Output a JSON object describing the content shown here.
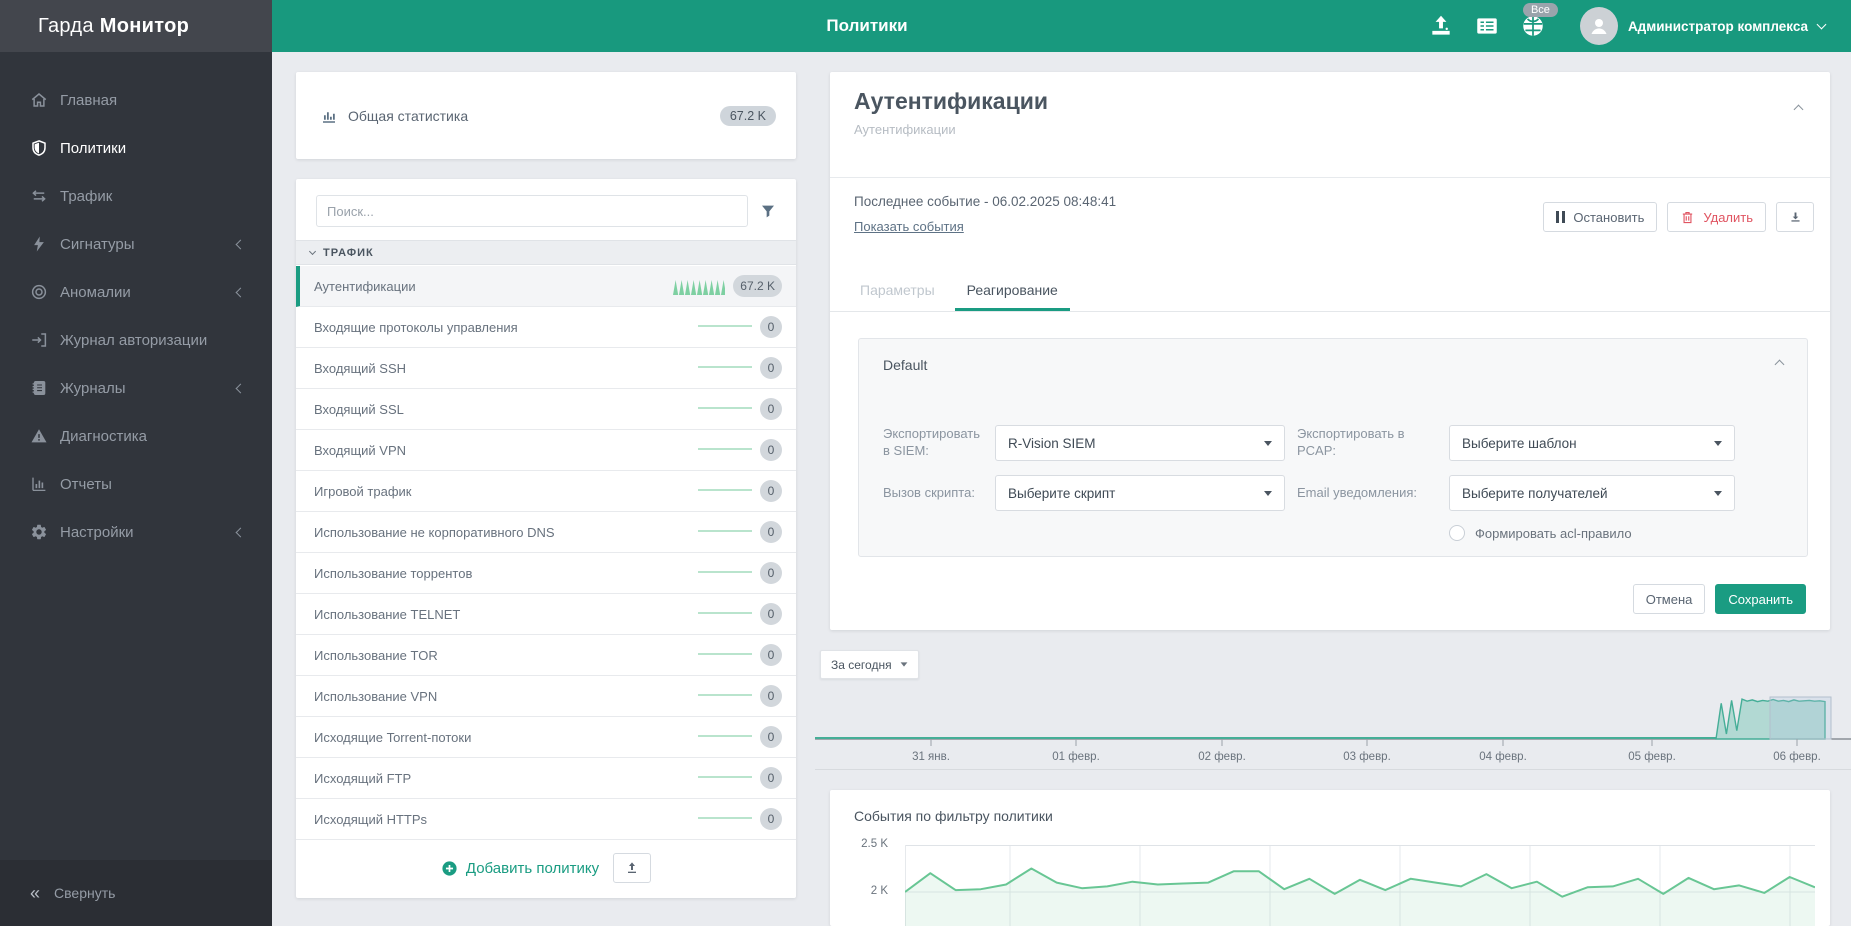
{
  "brand": {
    "regular": "Гарда",
    "bold": "Монитор"
  },
  "header": {
    "title": "Политики",
    "scope_badge": "Все",
    "user_name": "Администратор комплекса"
  },
  "sidebar": {
    "items": [
      {
        "label": "Главная",
        "icon": "home"
      },
      {
        "label": "Политики",
        "icon": "shield",
        "active": true
      },
      {
        "label": "Трафик",
        "icon": "swap"
      },
      {
        "label": "Сигнатуры",
        "icon": "bolt",
        "expandable": true
      },
      {
        "label": "Аномалии",
        "icon": "target",
        "expandable": true
      },
      {
        "label": "Журнал авторизации",
        "icon": "login"
      },
      {
        "label": "Журналы",
        "icon": "journal",
        "expandable": true
      },
      {
        "label": "Диагностика",
        "icon": "warning"
      },
      {
        "label": "Отчеты",
        "icon": "report"
      },
      {
        "label": "Настройки",
        "icon": "gear",
        "expandable": true
      }
    ],
    "collapse_label": "Свернуть"
  },
  "policies": {
    "stats_label": "Общая статистика",
    "stats_count": "67.2 K",
    "search_placeholder": "Поиск...",
    "group_label": "ТРАФИК",
    "items": [
      {
        "label": "Аутентификации",
        "count": "67.2 K",
        "selected": true
      },
      {
        "label": "Входящие протоколы управления",
        "count": "0"
      },
      {
        "label": "Входящий SSH",
        "count": "0"
      },
      {
        "label": "Входящий SSL",
        "count": "0"
      },
      {
        "label": "Входящий VPN",
        "count": "0"
      },
      {
        "label": "Игровой трафик",
        "count": "0"
      },
      {
        "label": "Использование не корпоративного DNS",
        "count": "0"
      },
      {
        "label": "Использование торрентов",
        "count": "0"
      },
      {
        "label": "Использование TELNET",
        "count": "0"
      },
      {
        "label": "Использование TOR",
        "count": "0"
      },
      {
        "label": "Использование VPN",
        "count": "0"
      },
      {
        "label": "Исходящие Torrent-потоки",
        "count": "0"
      },
      {
        "label": "Исходящий FTP",
        "count": "0"
      },
      {
        "label": "Исходящий HTTPs",
        "count": "0"
      }
    ],
    "add_button": "Добавить политику"
  },
  "detail": {
    "title": "Аутентификации",
    "subtitle": "Аутентификации",
    "last_event": "Последнее событие - 06.02.2025 08:48:41",
    "show_events_link": "Показать события",
    "stop_button": "Остановить",
    "delete_button": "Удалить",
    "tabs": [
      {
        "label": "Параметры",
        "active": false
      },
      {
        "label": "Реагирование",
        "active": true
      }
    ],
    "reaction": {
      "group_title": "Default",
      "fields": [
        {
          "label": "Экспортировать в SIEM:",
          "value": "R-Vision SIEM"
        },
        {
          "label": "Экспортировать в PCAP:",
          "value": "Выберите шаблон"
        },
        {
          "label": "Вызов скрипта:",
          "value": "Выберите скрипт"
        },
        {
          "label": "Email уведомления:",
          "value": "Выберите получателей"
        }
      ],
      "radio_label": "Формировать acl-правило",
      "cancel_button": "Отмена",
      "save_button": "Сохранить"
    },
    "period_button": "За сегодня"
  },
  "timeline": {
    "dates": [
      "31 янв.",
      "01 февр.",
      "02 февр.",
      "03 февр.",
      "04 февр.",
      "05 февр.",
      "06 февр."
    ],
    "burst_profile": [
      0,
      0.85,
      0.12,
      0.92,
      0.2,
      0.95,
      0.9,
      0.93,
      0.89,
      0.92,
      0.9,
      0.94,
      0.9,
      0.92,
      0.89,
      0.93,
      0.9,
      0.91,
      0.92,
      0.9,
      0.91,
      0.89
    ],
    "description": "flat at zero until late 05 февр., activity burst up to 06 февр. with brush selection on the right part",
    "accent": "#45ae97"
  },
  "chart_data": [
    {
      "type": "area",
      "title": "События по фильтру политики",
      "y_ticks": [
        "2.5 K",
        "2 K"
      ],
      "y_tick_values": [
        2500,
        2000
      ],
      "values": [
        2000,
        2200,
        2020,
        2030,
        2080,
        2250,
        2100,
        2040,
        2060,
        2110,
        2080,
        2090,
        2100,
        2220,
        2220,
        2030,
        2140,
        1980,
        2130,
        2020,
        2140,
        2100,
        2060,
        2190,
        2040,
        2110,
        1950,
        2050,
        2060,
        2140,
        1980,
        2150,
        2030,
        2070,
        1990,
        2160,
        2050
      ],
      "line_color": "#68c694",
      "grid": true,
      "legend": false
    },
    {
      "type": "area",
      "title": "timeline-overview",
      "x_ticks": [
        "31 янв.",
        "01 февр.",
        "02 февр.",
        "03 февр.",
        "04 февр.",
        "05 февр.",
        "06 февр."
      ],
      "values_note": "zero baseline with burst plateau near 06 февр.",
      "line_color": "#45ae97"
    }
  ],
  "colors": {
    "accent": "#1a9c82",
    "header_green": "#18997e",
    "danger": "#e05461",
    "sidebar": "#31353c"
  }
}
